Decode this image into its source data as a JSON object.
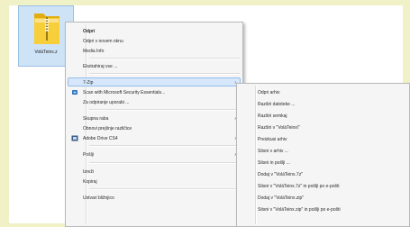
{
  "desktop": {
    "icon_label": "VoláTeinx.z"
  },
  "main_menu": {
    "items": [
      {
        "label": "Odpri"
      },
      {
        "label": "Odpri v novem oknu"
      },
      {
        "label": "Media Info"
      },
      {
        "label": "Ekstrahiraj vse ..."
      },
      {
        "label": "7-Zip",
        "arrow": "›"
      },
      {
        "label": "Scan with Microsoft Security Essentials..."
      },
      {
        "label": "Za odpiranje uporabi ..."
      },
      {
        "label": "Skupna raba",
        "arrow": "›"
      },
      {
        "label": "Obnovi prejšnje različice"
      },
      {
        "label": "Adobe Drive CS4",
        "arrow": "›"
      },
      {
        "label": "Pošlji",
        "arrow": "›"
      },
      {
        "label": "Izreži"
      },
      {
        "label": "Kopiraj"
      },
      {
        "label": "Ustvari bližnjico"
      }
    ]
  },
  "submenu_7zip": {
    "items": [
      {
        "label": "Odpri arhiv"
      },
      {
        "label": "Razširi datoteke ..."
      },
      {
        "label": "Razširi semkaj"
      },
      {
        "label": "Razširi v \"VoláTeinx\\\""
      },
      {
        "label": "Preizkusi arhiv"
      },
      {
        "label": "Stisni v arhiv ..."
      },
      {
        "label": "Stisni in pošlji ..."
      },
      {
        "label": "Dodaj v \"VoláTeinx.7z\""
      },
      {
        "label": "Stisni v \"VoláTeinx.7z\" in pošlji po e-pošti"
      },
      {
        "label": "Dodaj v \"VoláTeinx.zip\""
      },
      {
        "label": "Stisni v \"VoláTeinx.zip\" in pošlji po e-pošti"
      }
    ]
  },
  "colors": {
    "background": "#f1f1c8",
    "highlight": "#d7e7fb",
    "zip_folder": "#f3c51f"
  }
}
